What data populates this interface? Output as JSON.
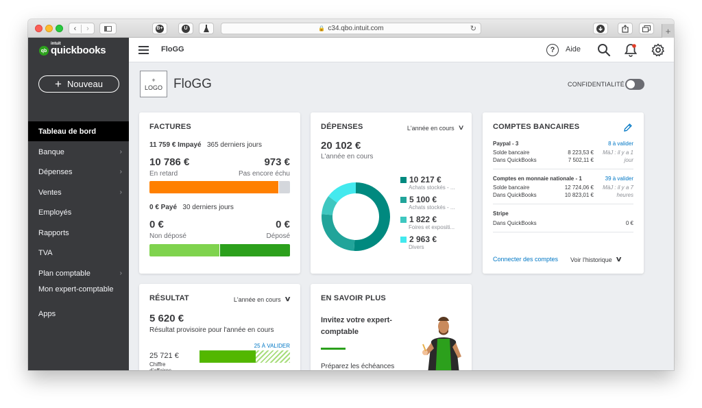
{
  "browser": {
    "url": "c34.qbo.intuit.com",
    "ext_badges": [
      "B+",
      "U"
    ]
  },
  "sidebar": {
    "logo_intuit": "intuit",
    "logo_text": "quickbooks",
    "logo_mark": "qb",
    "new_button": "Nouveau",
    "items": [
      {
        "label": "Tableau de bord",
        "active": true
      },
      {
        "label": "Banque",
        "chevron": true
      },
      {
        "label": "Dépenses",
        "chevron": true
      },
      {
        "label": "Ventes",
        "chevron": true
      },
      {
        "label": "Employés"
      },
      {
        "label": "Rapports"
      },
      {
        "label": "TVA"
      },
      {
        "label": "Plan comptable",
        "chevron": true
      },
      {
        "label": "Mon expert-comptable"
      },
      {
        "label": "Apps"
      }
    ]
  },
  "topbar": {
    "company": "FloGG",
    "help_glyph": "?",
    "help_label": "Aide"
  },
  "header": {
    "logo_plus": "+",
    "logo_label": "LOGO",
    "company_name": "FloGG",
    "privacy_label": "CONFIDENTIALITÉ"
  },
  "factures": {
    "title": "FACTURES",
    "unpaid_amount": "11 759 € Impayé",
    "unpaid_period": "365 derniers jours",
    "overdue_value": "10 786 €",
    "overdue_label": "En retard",
    "notdue_value": "973 €",
    "notdue_label": "Pas encore échu",
    "paid_amount": "0 € Payé",
    "paid_period": "30 derniers jours",
    "undeposited_value": "0 €",
    "undeposited_label": "Non déposé",
    "deposited_value": "0 €",
    "deposited_label": "Déposé",
    "colors": {
      "overdue": "#ff8000",
      "notdue": "#d4d7dc",
      "undeposited": "#7fd34e",
      "deposited": "#2ca01c"
    }
  },
  "depenses": {
    "title": "DÉPENSES",
    "period": "L'année en cours",
    "total": "20 102 €",
    "total_label": "L'année en cours",
    "items": [
      {
        "value": "10 217 €",
        "label": "Achats stockés - ...",
        "amount": 10217,
        "color": "#00897f"
      },
      {
        "value": "5 100 €",
        "label": "Achats stockés - ...",
        "amount": 5100,
        "color": "#21a49a"
      },
      {
        "value": "1 822 €",
        "label": "Foires et expositi...",
        "amount": 1822,
        "color": "#3ec7c0"
      },
      {
        "value": "2 963 €",
        "label": "Divers",
        "amount": 2963,
        "color": "#43e9ee"
      }
    ]
  },
  "comptes": {
    "title": "COMPTES BANCAIRES",
    "accounts": [
      {
        "name": "Paypal - 3",
        "link": "8 à valider",
        "bank_label": "Solde bancaire",
        "bank_value": "8 223,53 €",
        "qb_label": "Dans QuickBooks",
        "qb_value": "7 502,11 €",
        "maj1": "MàJ : il y a 1",
        "maj2": "jour"
      },
      {
        "name": "Comptes en monnaie nationale - 1",
        "link": "39 à valider",
        "bank_label": "Solde bancaire",
        "bank_value": "12 724,06 €",
        "qb_label": "Dans QuickBooks",
        "qb_value": "10 823,01 €",
        "maj1": "MàJ : il y a 7",
        "maj2": "heures"
      },
      {
        "name": "Stripe",
        "qb_label": "Dans QuickBooks",
        "qb_value": "0 €"
      }
    ],
    "connect_link": "Connecter des comptes",
    "history_link": "Voir l'historique"
  },
  "resultat": {
    "title": "RÉSULTAT",
    "period": "L'année en cours",
    "value": "5 620 €",
    "label": "Résultat provisoire pour l'année en cours",
    "to_validate": "25 À VALIDER",
    "revenue_value": "25 721 €",
    "revenue_label": "Chiffre d'affaires",
    "bar_fill": 0.62,
    "colors": {
      "bar": "#53b700",
      "hatch": "#a8dd7c"
    }
  },
  "savoir": {
    "title": "EN SAVOIR PLUS",
    "heading_line1": "Invitez votre expert-",
    "heading_line2": "comptable",
    "body": "Préparez les échéances"
  }
}
